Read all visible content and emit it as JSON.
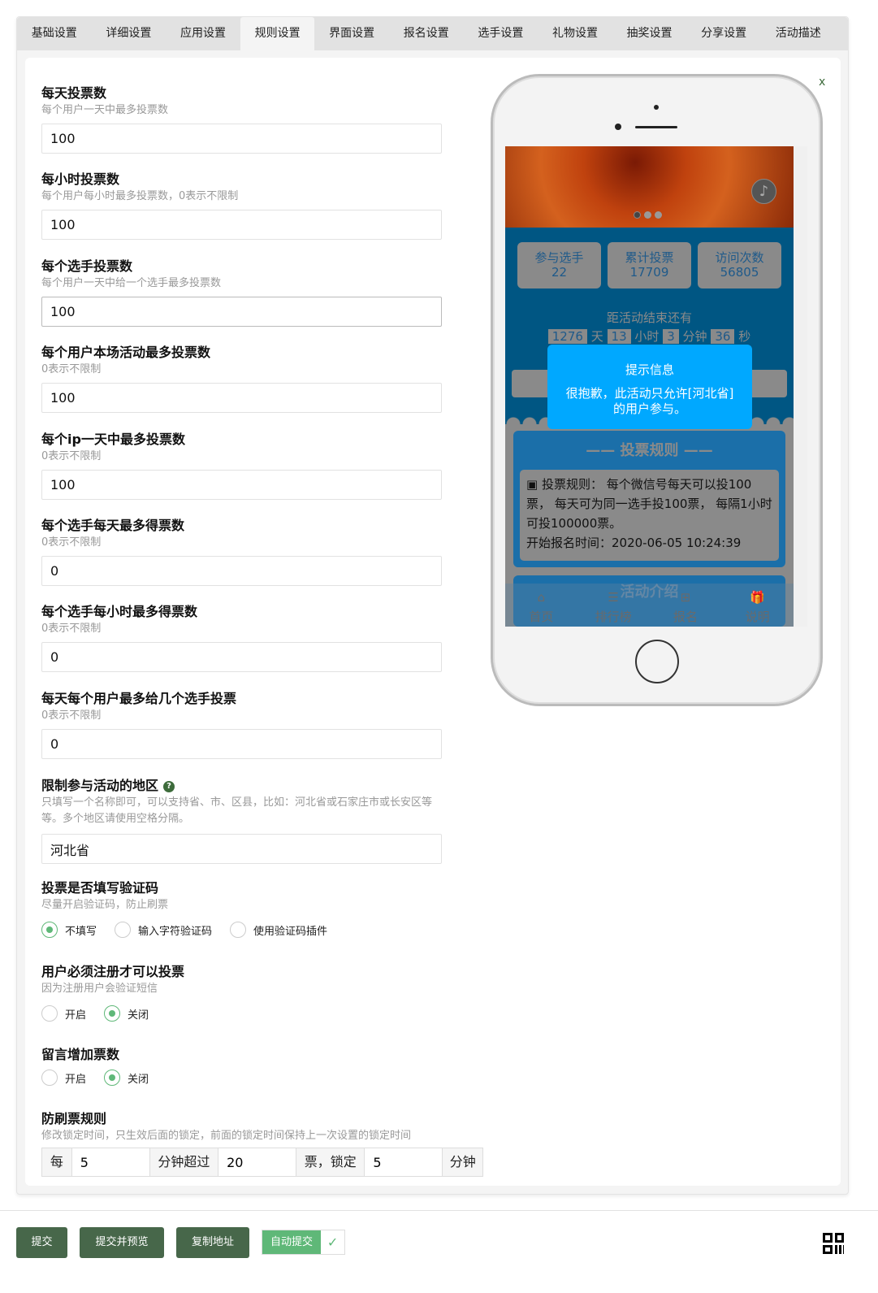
{
  "tabs": [
    "基础设置",
    "详细设置",
    "应用设置",
    "规则设置",
    "界面设置",
    "报名设置",
    "选手设置",
    "礼物设置",
    "抽奖设置",
    "分享设置",
    "活动描述"
  ],
  "active_tab": "规则设置",
  "close_label": "x",
  "fields": [
    {
      "label": "每天投票数",
      "hint": "每个用户一天中最多投票数",
      "value": "100"
    },
    {
      "label": "每小时投票数",
      "hint": "每个用户每小时最多投票数，0表示不限制",
      "value": "100"
    },
    {
      "label": "每个选手投票数",
      "hint": "每个用户一天中给一个选手最多投票数",
      "value": "100"
    },
    {
      "label": "每个用户本场活动最多投票数",
      "hint": "0表示不限制",
      "value": "100"
    },
    {
      "label": "每个ip一天中最多投票数",
      "hint": "0表示不限制",
      "value": "100"
    },
    {
      "label": "每个选手每天最多得票数",
      "hint": "0表示不限制",
      "value": "0"
    },
    {
      "label": "每个选手每小时最多得票数",
      "hint": "0表示不限制",
      "value": "0"
    },
    {
      "label": "每天每个用户最多给几个选手投票",
      "hint": "0表示不限制",
      "value": "0"
    }
  ],
  "region": {
    "label": "限制参与活动的地区",
    "hint": "只填写一个名称即可，可以支持省、市、区县，比如：河北省或石家庄市或长安区等等。多个地区请使用空格分隔。",
    "value": "河北省"
  },
  "captcha": {
    "label": "投票是否填写验证码",
    "hint": "尽量开启验证码，防止刷票",
    "options": [
      "不填写",
      "输入字符验证码",
      "使用验证码插件"
    ],
    "selected": "不填写"
  },
  "register": {
    "label": "用户必须注册才可以投票",
    "hint": "因为注册用户会验证短信",
    "options": [
      "开启",
      "关闭"
    ],
    "selected": "关闭"
  },
  "comment": {
    "label": "留言增加票数",
    "options": [
      "开启",
      "关闭"
    ],
    "selected": "关闭"
  },
  "anti": {
    "label": "防刷票规则",
    "hint": "修改锁定时间，只生效后面的锁定，前面的锁定时间保持上一次设置的锁定时间",
    "t1": "每",
    "v1": "5",
    "t2": "分钟超过",
    "v2": "20",
    "t3": "票，锁定",
    "v3": "5",
    "t4": "分钟"
  },
  "preview": {
    "stats": [
      {
        "label": "参与选手",
        "value": "22"
      },
      {
        "label": "累计投票",
        "value": "17709"
      },
      {
        "label": "访问次数",
        "value": "56805"
      }
    ],
    "countdown_title": "距活动结束还有",
    "countdown": {
      "days": "1276",
      "d": "天",
      "hours": "13",
      "h": "小时",
      "minutes": "3",
      "m": "分钟",
      "seconds": "36",
      "s": "秒"
    },
    "toast_title": "提示信息",
    "toast_msg": "很抱歉，此活动只允许[河北省]的用户参与。",
    "rules_title": "投票规则",
    "rules_text": "投票规则： 每个微信号每天可以投100票， 每天可为同一选手投100票， 每隔1小时可投100000票。",
    "rules_time": "开始报名时间：2020-06-05 10:24:39",
    "intro_title": "活动介绍",
    "nav": [
      "首页",
      "排行榜",
      "报名",
      "说明"
    ]
  },
  "footer": {
    "submit": "提交",
    "submit_preview": "提交并预览",
    "copy": "复制地址",
    "auto": "自动提交",
    "auto_on": true
  },
  "colors": {
    "primary": "#47674a",
    "radio": "#5fb878",
    "toast": "#00a8ff",
    "phone_bg": "#005683"
  }
}
